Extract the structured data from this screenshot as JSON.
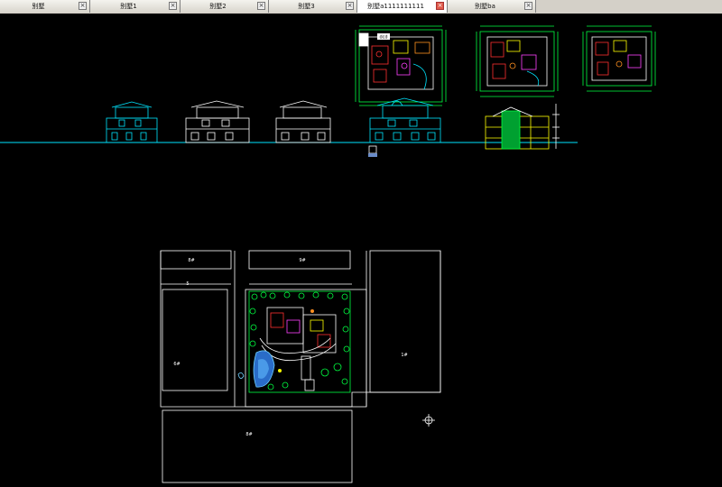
{
  "tabs": [
    {
      "label": "别墅",
      "close": "×",
      "active": false
    },
    {
      "label": "别墅1",
      "close": "×",
      "active": false
    },
    {
      "label": "别墅2",
      "close": "×",
      "active": false
    },
    {
      "label": "别墅3",
      "close": "×",
      "active": false
    },
    {
      "label": "别墅a1111111111",
      "close": "×",
      "active": true
    },
    {
      "label": "别墅ba",
      "close": "×",
      "active": false
    }
  ],
  "drawing": {
    "plan_badge": "dcd",
    "site_labels": {
      "top_left": "8#",
      "top_mid": "9#",
      "left_big": "6#",
      "right_big": "1#",
      "bottom": "8#",
      "road_mark": "5"
    }
  },
  "colors": {
    "background": "#000000",
    "line_white": "#ffffff",
    "cyan": "#00e5ff",
    "green": "#00ff40",
    "yellow": "#ffff00",
    "red": "#ff3030",
    "magenta": "#ff40ff",
    "orange": "#ff9020"
  }
}
